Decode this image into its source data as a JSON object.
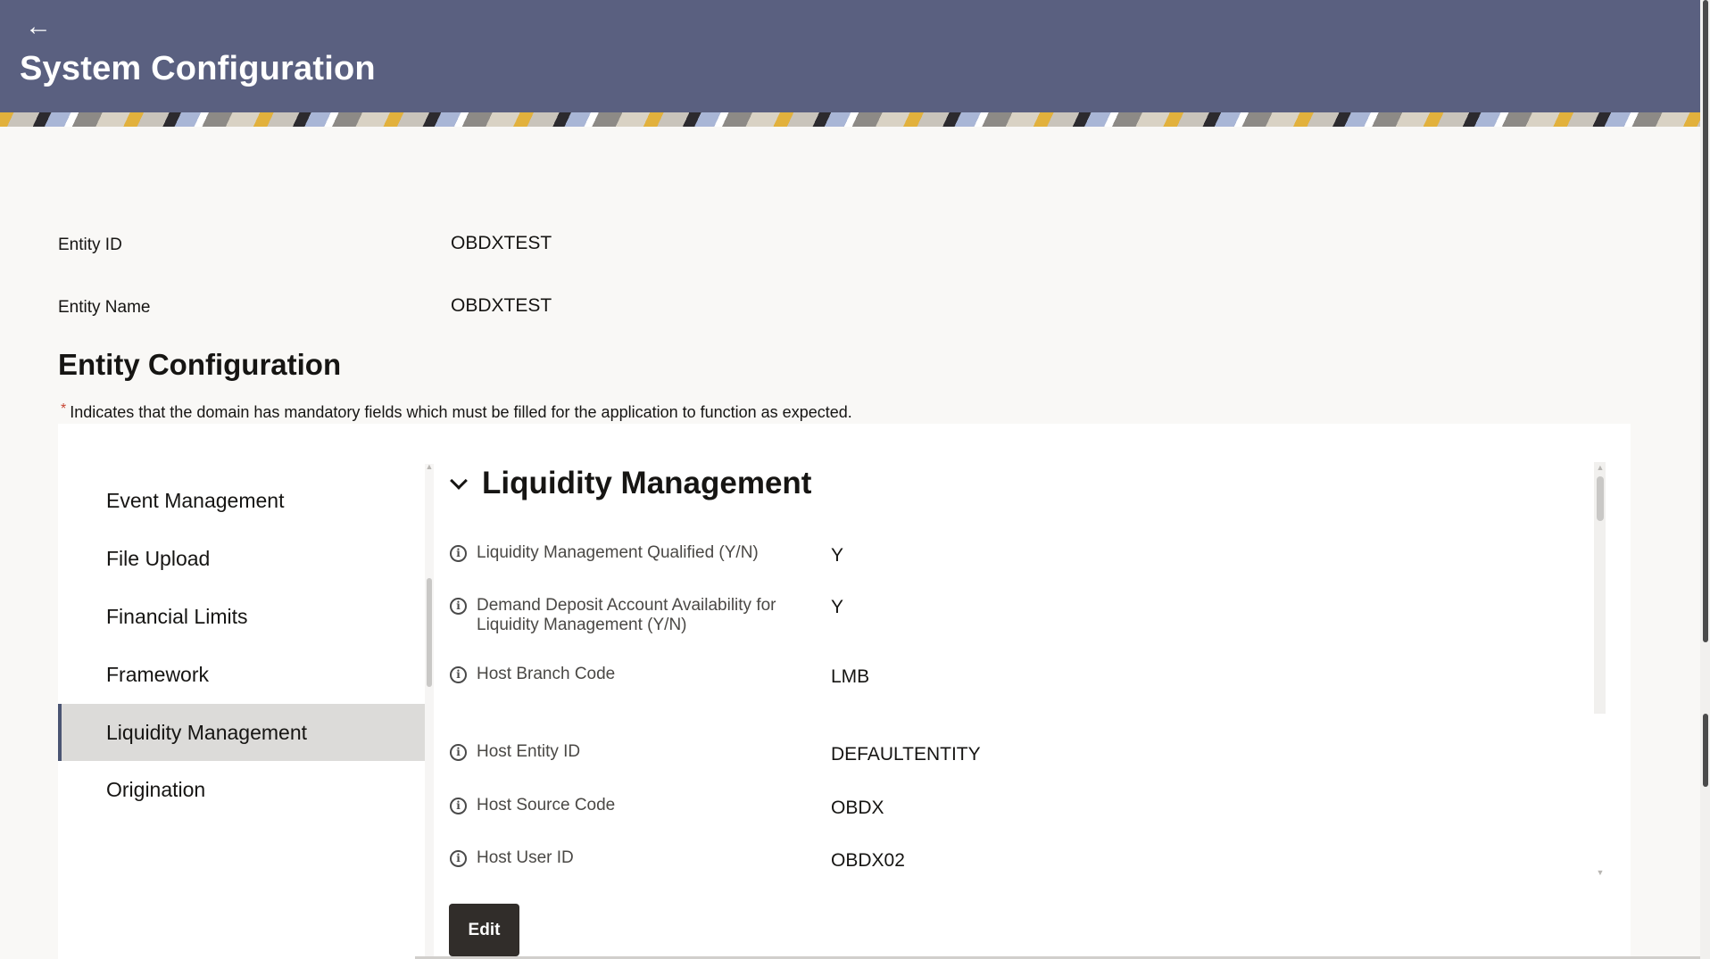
{
  "header": {
    "back_icon": "arrow-left-icon",
    "title": "System Configuration"
  },
  "entity": {
    "id_label": "Entity ID",
    "id_value": "OBDXTEST",
    "name_label": "Entity Name",
    "name_value": "OBDXTEST"
  },
  "section": {
    "title": "Entity Configuration",
    "note_star": "*",
    "note": "Indicates that the domain has mandatory fields which must be filled for the application to function as expected."
  },
  "sidebar": {
    "items": [
      {
        "label": "Event Management",
        "active": false
      },
      {
        "label": "File Upload",
        "active": false
      },
      {
        "label": "Financial Limits",
        "active": false
      },
      {
        "label": "Framework",
        "active": false
      },
      {
        "label": "Liquidity Management",
        "active": true
      },
      {
        "label": "Origination",
        "active": false
      }
    ]
  },
  "content": {
    "title": "Liquidity Management",
    "fields": [
      {
        "label": "Liquidity Management Qualified (Y/N)",
        "value": "Y"
      },
      {
        "label": "Demand Deposit Account Availability for Liquidity Management (Y/N)",
        "value": "Y"
      },
      {
        "label": "Host Branch Code",
        "value": "LMB"
      },
      {
        "label": "Host Entity ID",
        "value": "DEFAULTENTITY"
      },
      {
        "label": "Host Source Code",
        "value": "OBDX"
      },
      {
        "label": "Host User ID",
        "value": "OBDX02"
      }
    ],
    "edit_label": "Edit"
  },
  "colors": {
    "header_bg": "#5a6080",
    "active_item_bg": "#dcdbd9",
    "edit_button_bg": "#312d2a",
    "mandatory_star": "#c74634"
  }
}
